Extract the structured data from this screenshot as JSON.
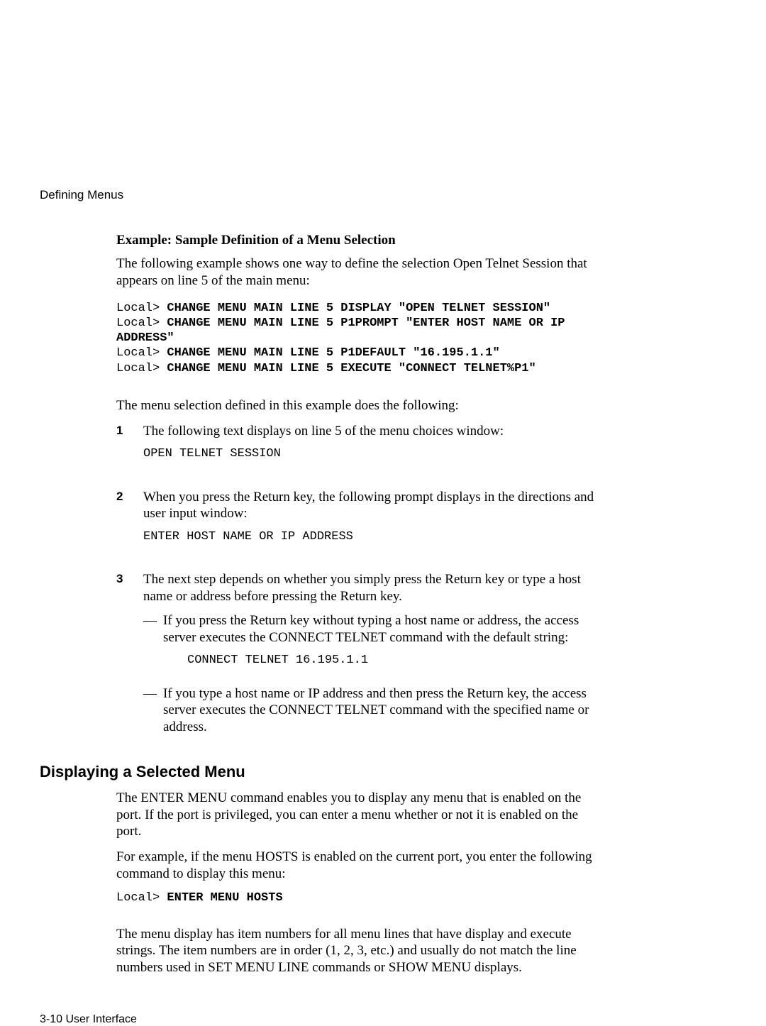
{
  "running_header": "Defining Menus",
  "example_heading": "Example: Sample Definition of a Menu Selection",
  "example_intro": "The following example shows one way to define the selection Open Telnet Session that appears on line 5 of the main menu:",
  "code": {
    "prompt": "Local>",
    "line1": "CHANGE MENU MAIN LINE 5 DISPLAY \"OPEN TELNET SESSION\"",
    "line2": "CHANGE MENU MAIN LINE 5 P1PROMPT \"ENTER HOST NAME OR IP ADDRESS\"",
    "line3": "CHANGE MENU MAIN LINE 5 P1DEFAULT \"16.195.1.1\"",
    "line4": "CHANGE MENU MAIN LINE 5 EXECUTE \"CONNECT TELNET%P1\""
  },
  "menu_sel_intro": "The menu selection defined in this example does the following:",
  "steps": [
    {
      "num": "1",
      "text": "The following text displays on line 5 of the menu choices window:",
      "mono": "OPEN TELNET SESSION"
    },
    {
      "num": "2",
      "text": "When you press the Return key, the following prompt displays in the directions and user input window:",
      "mono": "ENTER HOST NAME OR IP ADDRESS"
    },
    {
      "num": "3",
      "text": "The next step depends on whether you simply press the Return key or type a host name or address before pressing the Return key.",
      "bullets": [
        {
          "text": "If you press the Return key without typing a host name or address, the access server executes the CONNECT TELNET command with the default string:",
          "mono": "CONNECT TELNET 16.195.1.1"
        },
        {
          "text": "If you type a host name or IP address and then press the Return key, the access server executes the CONNECT TELNET command with the specified name or address."
        }
      ]
    }
  ],
  "section2": {
    "heading": "Displaying a Selected Menu",
    "p1": "The ENTER MENU command enables you to display any menu that is enabled on the port. If the port is privileged, you can enter a menu whether or not it is enabled on the port.",
    "p2": "For example, if the menu HOSTS is enabled on the current port, you enter the following command to display this menu:",
    "cmd": "ENTER MENU HOSTS",
    "p3": "The menu display has item numbers for all menu lines that have display and execute strings. The item numbers are in order (1, 2, 3, etc.) and usually do not match the line numbers used in SET MENU LINE commands or SHOW MENU displays."
  },
  "footer": "3-10  User Interface"
}
